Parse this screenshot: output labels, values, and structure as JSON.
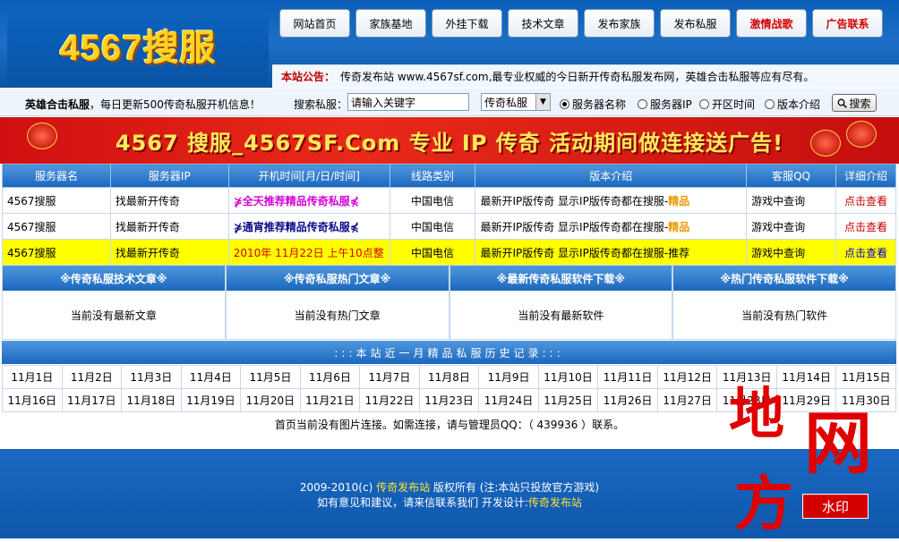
{
  "header": {
    "logo_text": "4567搜服",
    "nav": [
      {
        "label": "网站首页",
        "red": false
      },
      {
        "label": "家族基地",
        "red": false
      },
      {
        "label": "外挂下载",
        "red": false
      },
      {
        "label": "技术文章",
        "red": false
      },
      {
        "label": "发布家族",
        "red": false
      },
      {
        "label": "发布私服",
        "red": false
      },
      {
        "label": "激情战歌",
        "red": true
      },
      {
        "label": "广告联系",
        "red": true
      }
    ],
    "notice_label": "本站公告：",
    "notice_text": "传奇发布站 www.4567sf.com,最专业权威的今日新开传奇私服发布网，英雄合击私服等应有尽有。"
  },
  "searchbar": {
    "tagline_bold": "英雄合击私服",
    "tagline_rest": "，每日更新500传奇私服开机信息！",
    "search_label": "搜索私服：",
    "search_value": "请输入关键字",
    "select_value": "传奇私服",
    "radios": [
      {
        "label": "服务器名称",
        "checked": true
      },
      {
        "label": "服务器IP",
        "checked": false
      },
      {
        "label": "开区时间",
        "checked": false
      },
      {
        "label": "版本介绍",
        "checked": false
      }
    ],
    "search_button": "搜索"
  },
  "banner": {
    "text": "4567 搜服_4567SF.Com  专业 IP 传奇  活动期间做连接送广告!"
  },
  "server_table": {
    "headers": [
      "服务器名",
      "服务器IP",
      "开机时间[月/日/时间]",
      "线路类别",
      "版本介绍",
      "客服QQ",
      "详细介绍"
    ],
    "rows": [
      {
        "name": "4567搜服",
        "ip": "找最新开传奇",
        "time": "⋡全天推荐精品传奇私服⋠",
        "line": "中国电信",
        "version": "最新开IP版传奇 显示IP版传奇都在搜服-",
        "version_tag": "精品",
        "qq": "游戏中查询",
        "detail": "点击查看"
      },
      {
        "name": "4567搜服",
        "ip": "找最新开传奇",
        "time": "⋡通宵推荐精品传奇私服⋠",
        "line": "中国电信",
        "version": "最新开IP版传奇 显示IP版传奇都在搜服-",
        "version_tag": "精品",
        "qq": "游戏中查询",
        "detail": "点击查看"
      },
      {
        "name": "4567搜服",
        "ip": "找最新开传奇",
        "time": "2010年 11月22日 上午10点整",
        "line": "中国电信",
        "version": "最新开IP版传奇 显示IP版传奇都在搜服-推荐",
        "version_tag": "",
        "qq": "游戏中查询",
        "detail": "点击查看"
      }
    ]
  },
  "sections": [
    {
      "title": "※传奇私服技术文章※",
      "body": "当前没有最新文章"
    },
    {
      "title": "※传奇私服热门文章※",
      "body": "当前没有热门文章"
    },
    {
      "title": "※最新传奇私服软件下载※",
      "body": "当前没有最新软件"
    },
    {
      "title": "※热门传奇私服软件下载※",
      "body": "当前没有热门软件"
    }
  ],
  "history": {
    "title": ":::本站近一月精品私服历史记录:::",
    "row1": [
      "11月1日",
      "11月2日",
      "11月3日",
      "11月4日",
      "11月5日",
      "11月6日",
      "11月7日",
      "11月8日",
      "11月9日",
      "11月10日",
      "11月11日",
      "11月12日",
      "11月13日",
      "11月14日",
      "11月15日"
    ],
    "row2": [
      "11月16日",
      "11月17日",
      "11月18日",
      "11月19日",
      "11月20日",
      "11月21日",
      "11月22日",
      "11月23日",
      "11月24日",
      "11月25日",
      "11月26日",
      "11月27日",
      "11月28日",
      "11月29日",
      "11月30日"
    ]
  },
  "links_note": "首页当前没有图片连接。如需连接，请与管理员QQ：（ 439936 ）联系。",
  "footer": {
    "line1_a": "2009-2010(c) ",
    "line1_site": "传奇发布站",
    "line1_b": " 版权所有 (注:本站只投放官方游戏)",
    "line2_a": "如有意见和建议，请来信联系我们  开发设计:",
    "line2_site": "传奇发布站"
  },
  "watermark": {
    "chars": [
      "地",
      "网",
      "方"
    ],
    "tag": "水印"
  }
}
